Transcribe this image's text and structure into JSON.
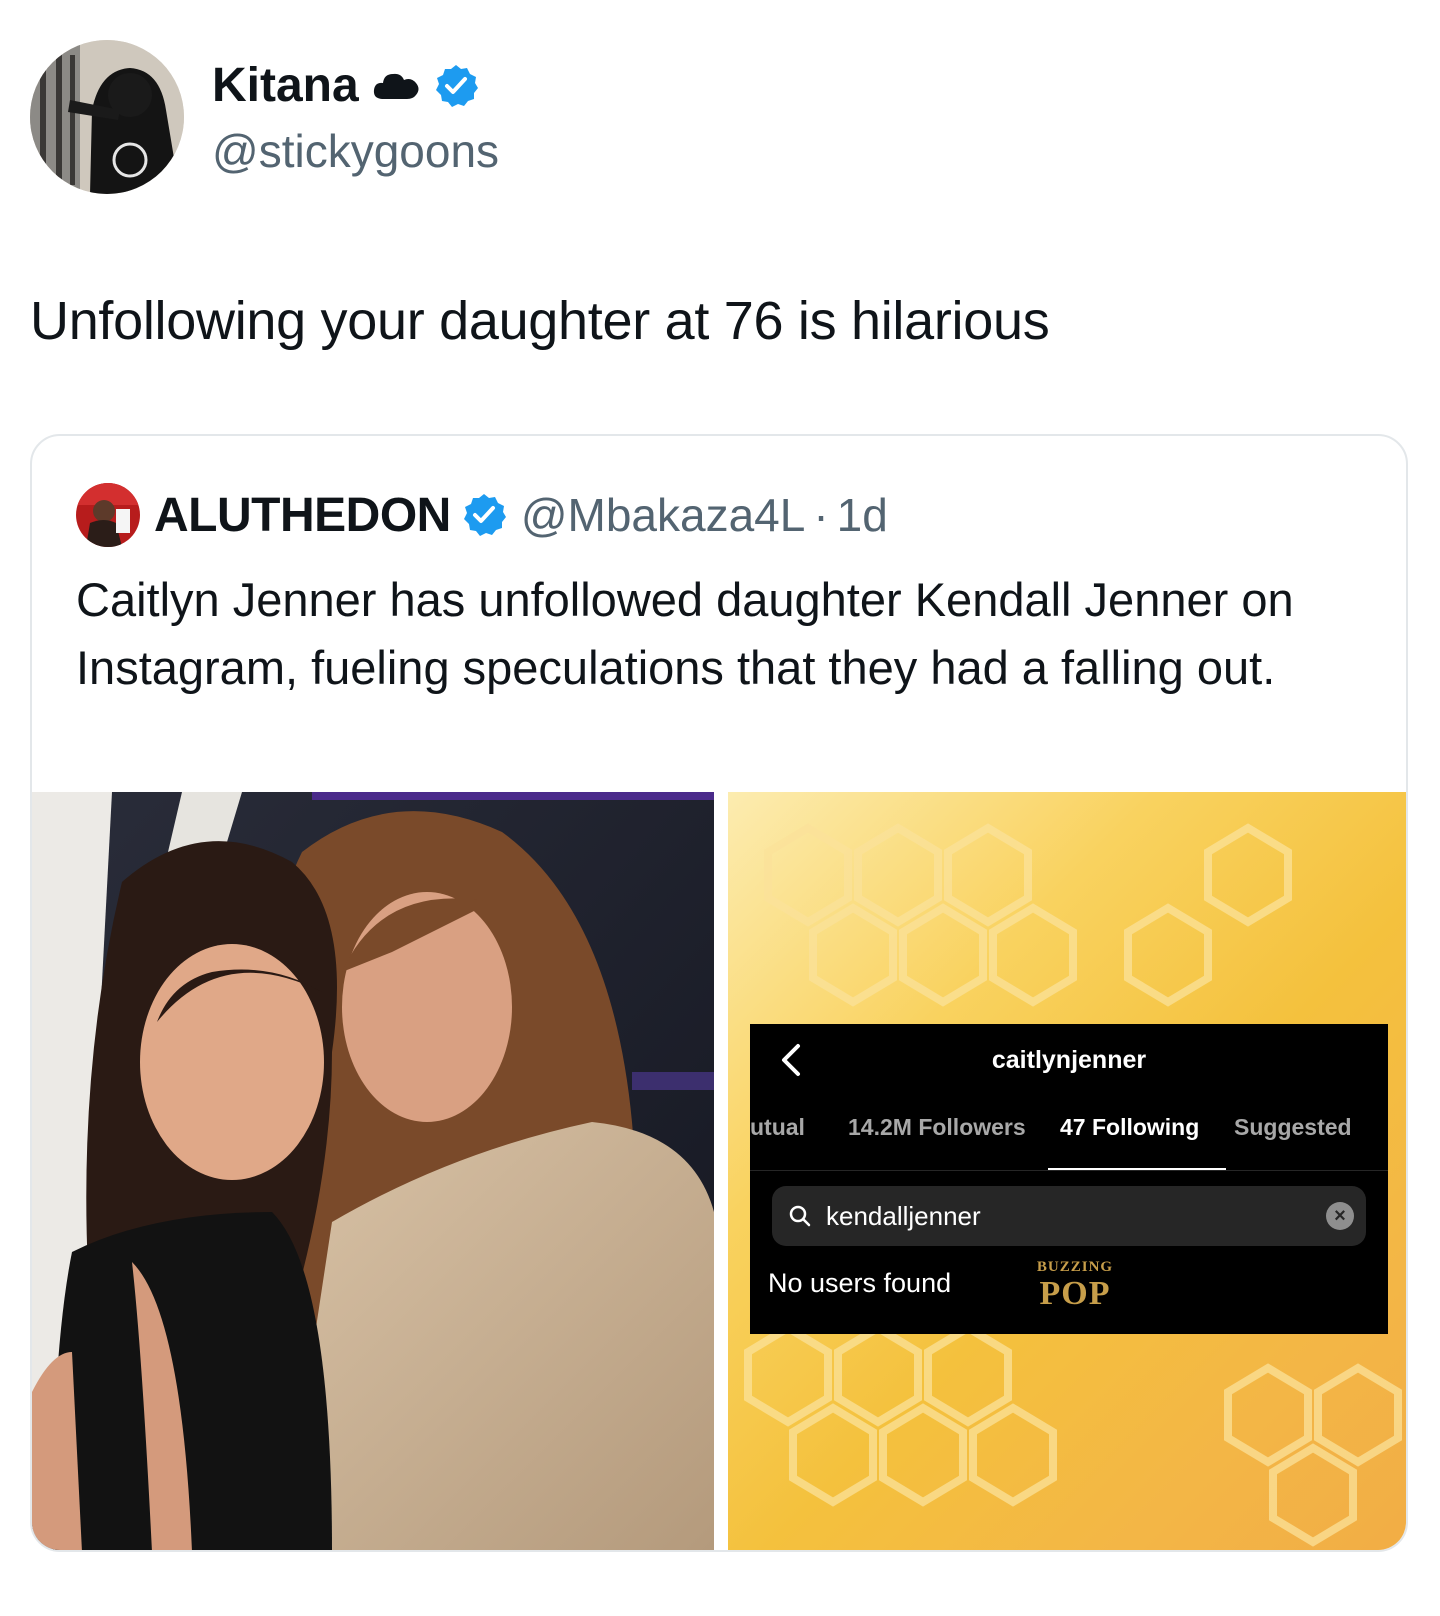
{
  "tweet": {
    "author_name": "Kitana",
    "author_handle": "@stickygoons",
    "verified": true,
    "name_emoji_icon": "cloud-icon",
    "text": "Unfollowing your daughter at 76 is hilarious"
  },
  "quoted_tweet": {
    "author_name": "ALUTHEDON",
    "verified": true,
    "author_handle": "@Mbakaza4L",
    "separator": "·",
    "time": "1d",
    "text": "Caitlyn Jenner has unfollowed daughter Kendall Jenner on Instagram, fueling speculations that they had a falling out."
  },
  "media_right": {
    "username": "caitlynjenner",
    "tabs": [
      {
        "label": "utual",
        "active": false
      },
      {
        "label": "14.2M Followers",
        "active": false
      },
      {
        "label": "47 Following",
        "active": true
      },
      {
        "label": "Suggested",
        "active": false
      }
    ],
    "search_value": "kendalljenner",
    "empty_message": "No users found",
    "watermark_top": "BUZZING",
    "watermark_bottom": "POP"
  },
  "colors": {
    "verified_blue": "#1d9bf0",
    "secondary_text": "#536471",
    "honeycomb_yellow": "#f6c845"
  }
}
